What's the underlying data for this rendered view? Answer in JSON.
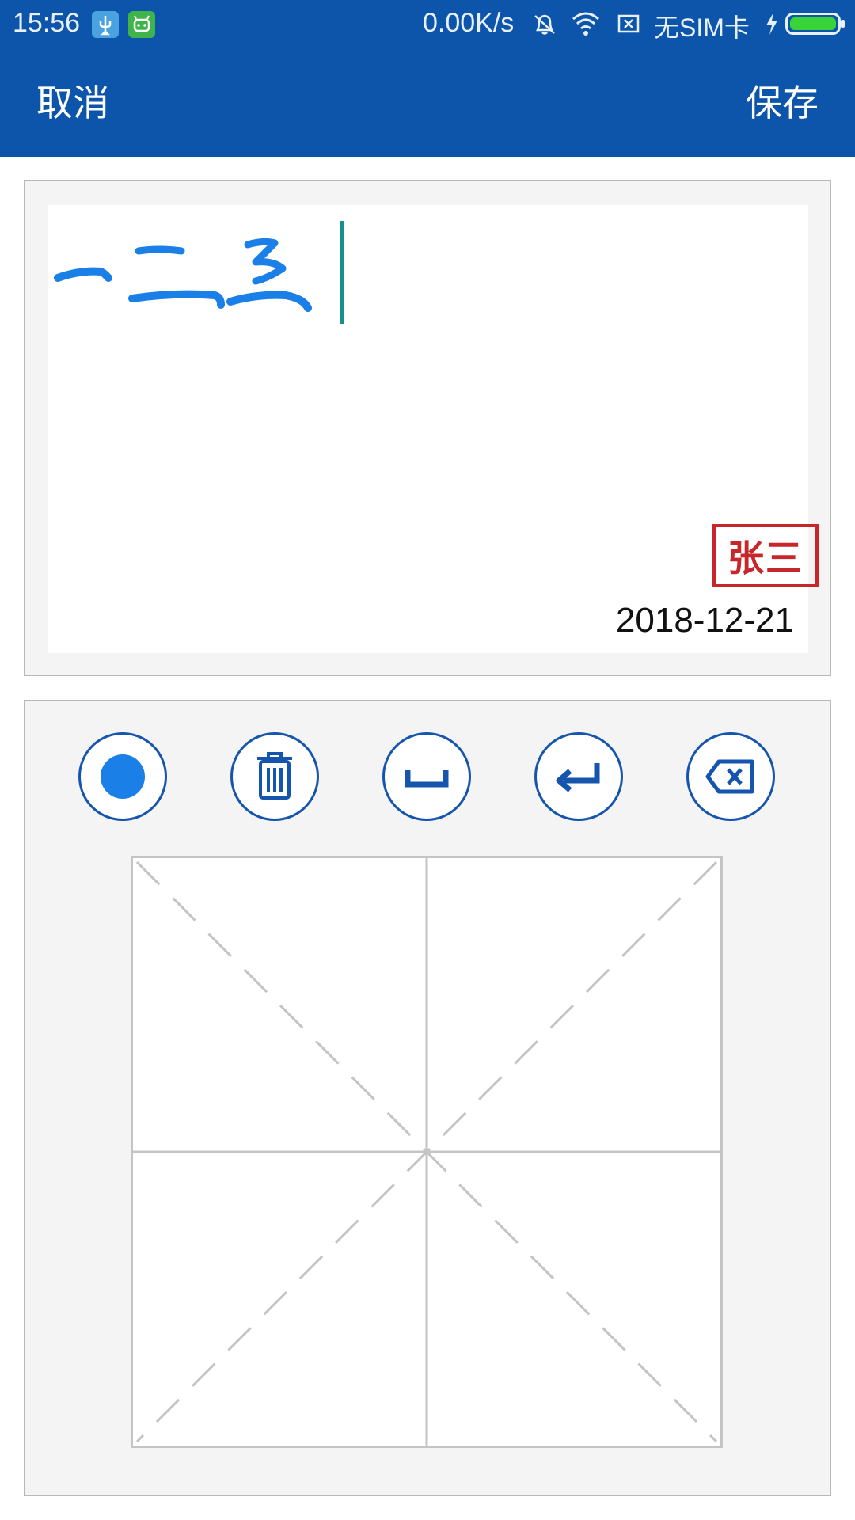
{
  "status_bar": {
    "time": "15:56",
    "network_speed": "0.00K/s",
    "sim_status": "无SIM卡",
    "icons": [
      "usb-icon",
      "android-icon",
      "mute-icon",
      "wifi-icon",
      "sim-error-icon",
      "charging-icon",
      "battery-icon"
    ]
  },
  "header": {
    "cancel_label": "取消",
    "save_label": "保存",
    "background_color": "#0d55ab"
  },
  "preview": {
    "handwritten_text": "一二3",
    "stroke_color": "#1a7fe6",
    "cursor_color": "#149189",
    "stamp_text": "张三",
    "stamp_color": "#c7262b",
    "date": "2018-12-21"
  },
  "toolbar": {
    "tools": [
      {
        "name": "pen-color",
        "icon": "dot-icon"
      },
      {
        "name": "clear",
        "icon": "trash-icon"
      },
      {
        "name": "space",
        "icon": "space-icon"
      },
      {
        "name": "newline",
        "icon": "enter-icon"
      },
      {
        "name": "delete",
        "icon": "backspace-icon"
      }
    ],
    "accent_color": "#1555ad",
    "pen_color": "#1a7fe6"
  },
  "handwriting_pad": {
    "type": "米字格"
  }
}
